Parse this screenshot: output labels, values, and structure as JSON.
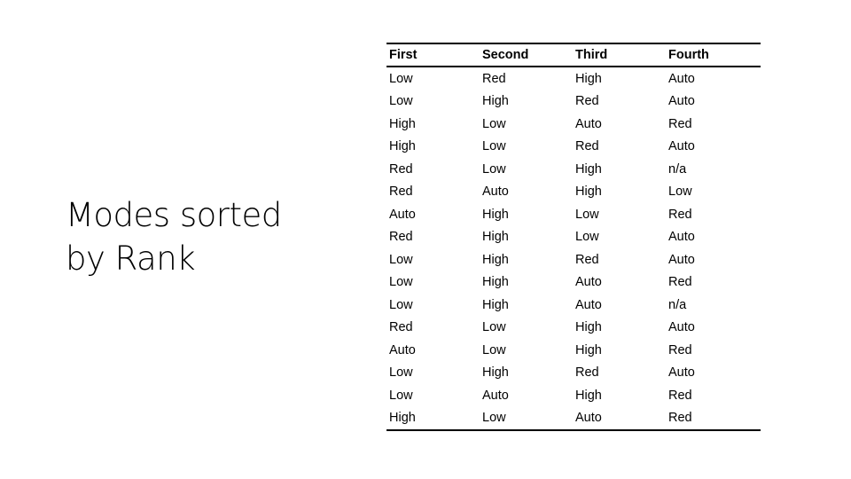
{
  "slide": {
    "title_line1": "Modes sorted",
    "title_line2": "by Rank"
  },
  "table": {
    "headers": [
      "First",
      "Second",
      "Third",
      "Fourth"
    ],
    "rows": [
      [
        "Low",
        "Red",
        "High",
        "Auto"
      ],
      [
        "Low",
        "High",
        "Red",
        "Auto"
      ],
      [
        "High",
        "Low",
        "Auto",
        "Red"
      ],
      [
        "High",
        "Low",
        "Red",
        "Auto"
      ],
      [
        "Red",
        "Low",
        "High",
        "n/a"
      ],
      [
        "Red",
        "Auto",
        "High",
        "Low"
      ],
      [
        "Auto",
        "High",
        "Low",
        "Red"
      ],
      [
        "Red",
        "High",
        "Low",
        "Auto"
      ],
      [
        "Low",
        "High",
        "Red",
        "Auto"
      ],
      [
        "Low",
        "High",
        "Auto",
        "Red"
      ],
      [
        "Low",
        "High",
        "Auto",
        "n/a"
      ],
      [
        "Red",
        "Low",
        "High",
        "Auto"
      ],
      [
        "Auto",
        "Low",
        "High",
        "Red"
      ],
      [
        "Low",
        "High",
        "Red",
        "Auto"
      ],
      [
        "Low",
        "Auto",
        "High",
        "Red"
      ],
      [
        "High",
        "Low",
        "Auto",
        "Red"
      ]
    ]
  }
}
